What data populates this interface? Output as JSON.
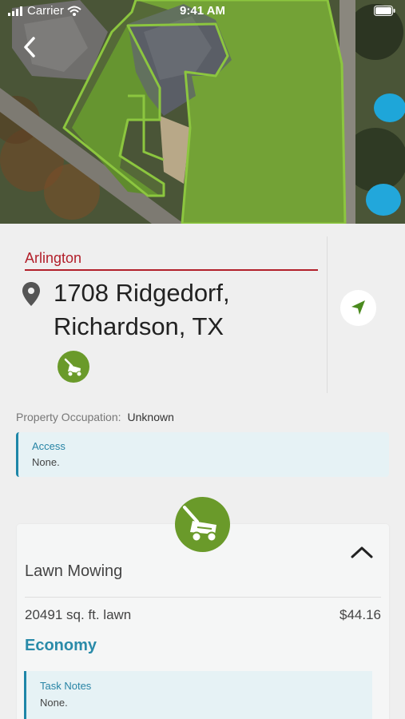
{
  "status_bar": {
    "carrier": "Carrier",
    "time": "9:41 AM"
  },
  "property": {
    "region": "Arlington",
    "address": "1708 Ridgedorf, Richardson, TX",
    "occupation_label": "Property Occupation:",
    "occupation_value": "Unknown"
  },
  "access": {
    "title": "Access",
    "value": "None."
  },
  "service": {
    "title": "Lawn Mowing",
    "lawn_size": "20491 sq. ft. lawn",
    "price": "$44.16",
    "tier": "Economy",
    "notes_title": "Task Notes",
    "notes_value": "None."
  },
  "colors": {
    "accent_red": "#b21f2a",
    "accent_blue": "#2a8ba9",
    "service_green": "#6a9a2a",
    "boundary_green": "#8cc63f"
  },
  "icons": [
    "back-chevron-icon",
    "location-pin-icon",
    "lawn-mower-icon",
    "navigation-arrow-icon",
    "chevron-up-icon",
    "wifi-icon",
    "signal-icon",
    "battery-icon"
  ]
}
